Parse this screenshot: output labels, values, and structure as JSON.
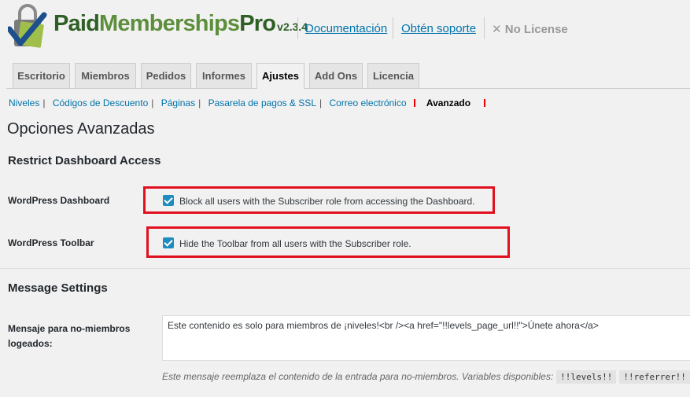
{
  "header": {
    "brand_paid": "Paid",
    "brand_memberships": "Memberships",
    "brand_pro": "Pro",
    "version": "v2.3.4",
    "doc_link": "Documentación",
    "support_link": "Obtén soporte",
    "license": "No License",
    "license_icon": "close-icon"
  },
  "tabs": [
    "Escritorio",
    "Miembros",
    "Pedidos",
    "Informes",
    "Ajustes",
    "Add Ons",
    "Licencia"
  ],
  "active_tab": "Ajustes",
  "subnav": {
    "items": [
      "Niveles",
      "Códigos de Descuento",
      "Páginas",
      "Pasarela de pagos & SSL",
      "Correo electrónico"
    ],
    "current": "Avanzado"
  },
  "page_title": "Opciones Avanzadas",
  "restrict": {
    "title": "Restrict Dashboard Access",
    "dashboard_label": "WordPress Dashboard",
    "dashboard_checkbox": "Block all users with the Subscriber role from accessing the Dashboard.",
    "dashboard_checked": true,
    "toolbar_label": "WordPress Toolbar",
    "toolbar_checkbox": "Hide the Toolbar from all users with the Subscriber role.",
    "toolbar_checked": true
  },
  "message": {
    "title": "Message Settings",
    "field_label_1": "Mensaje para no-miembros",
    "field_label_2": "logeados:",
    "textarea_value": "Este contenido es solo para miembros de ¡niveles!<br /><a href=\"!!levels_page_url!!\">Únete ahora</a>",
    "description": "Este mensaje reemplaza el contenido de la entrada para no-miembros. Variables disponibles:",
    "var1": "!!levels!!",
    "var2": "!!referrer!!"
  },
  "colors": {
    "accent": "#0073aa",
    "checkbox": "#1e8cbe",
    "highlight": "#e0101e",
    "brand_dark": "#2e5f24",
    "brand_light": "#5d8e3b"
  }
}
